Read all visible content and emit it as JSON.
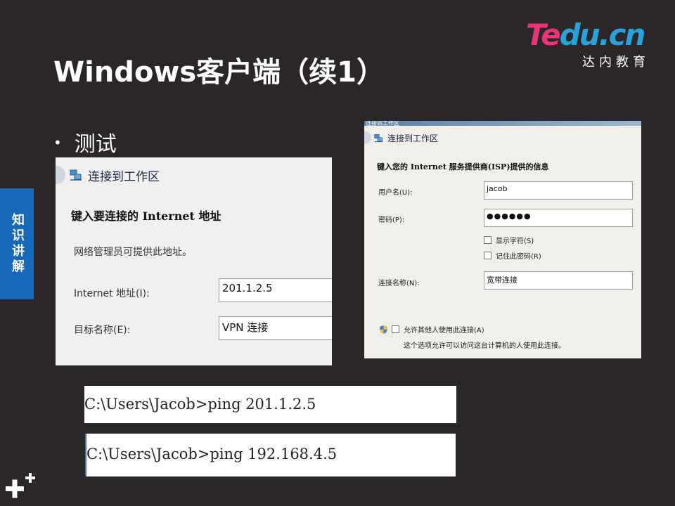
{
  "slide": {
    "title": "Windows客户端（续1）",
    "bullet": "测试",
    "side_tab": "知识讲解"
  },
  "logo": {
    "main_a": "Te",
    "main_b": "du.cn",
    "sub": "达内教育"
  },
  "dialog_left": {
    "header": "连接到工作区",
    "heading": "键入要连接的 Internet 地址",
    "description": "网络管理员可提供此地址。",
    "address_label": "Internet 地址(I):",
    "address_value": "201.1.2.5",
    "dest_label": "目标名称(E):",
    "dest_value": "VPN 连接"
  },
  "dialog_right": {
    "top_strip": "连接到工作区",
    "header": "连接到工作区",
    "heading": "键入您的 Internet 服务提供商(ISP)提供的信息",
    "username_label": "用户名(U):",
    "username_value": "jacob",
    "password_label": "密码(P):",
    "password_value": "●●●●●●",
    "show_chars_label": "显示字符(S)",
    "remember_label": "记住此密码(R)",
    "conn_name_label": "连接名称(N):",
    "conn_name_value": "宽带连接",
    "allow_label": "允许其他人使用此连接(A)",
    "allow_note": "这个选项允许可以访问这台计算机的人使用此连接。"
  },
  "commands": [
    "C:\\Users\\Jacob>ping 201.1.2.5",
    "C:\\Users\\Jacob>ping 192.168.4.5"
  ],
  "colors": {
    "background": "#2b2728",
    "side_tab": "#1668b8",
    "logo_pink": "#e8357a",
    "logo_blue": "#27a3dc"
  }
}
